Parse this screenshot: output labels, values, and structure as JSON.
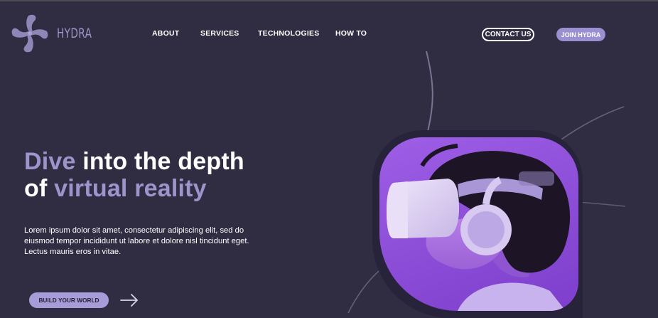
{
  "brand": {
    "name": "HYDRA",
    "logo_icon": "hydra-swirl-logo"
  },
  "nav": {
    "items": [
      {
        "label": "ABOUT"
      },
      {
        "label": "SERVICES"
      },
      {
        "label": "TECHNOLOGIES"
      },
      {
        "label": "HOW TO"
      }
    ],
    "contact_label": "CONTACT US",
    "join_label": "JOIN HYDRA"
  },
  "hero": {
    "headline_line1_accent": "Dive",
    "headline_line1_rest": " into the depth",
    "headline_line2_prefix": "of ",
    "headline_line2_accent": "virtual reality",
    "body": "Lorem ipsum dolor sit amet, consectetur adipiscing elit, sed do eiusmod tempor incididunt ut labore et dolore nisl tincidunt eget. Lectus mauris eros in vitae.",
    "cta_label": "BUILD YOUR WORLD",
    "cta_icon": "arrow-right-icon",
    "image_subject": "vr-headset-photo"
  },
  "colors": {
    "background": "#302c42",
    "accent": "#9e94cc",
    "button": "#9a8fd0",
    "image_purple": "#9e5ee6"
  }
}
